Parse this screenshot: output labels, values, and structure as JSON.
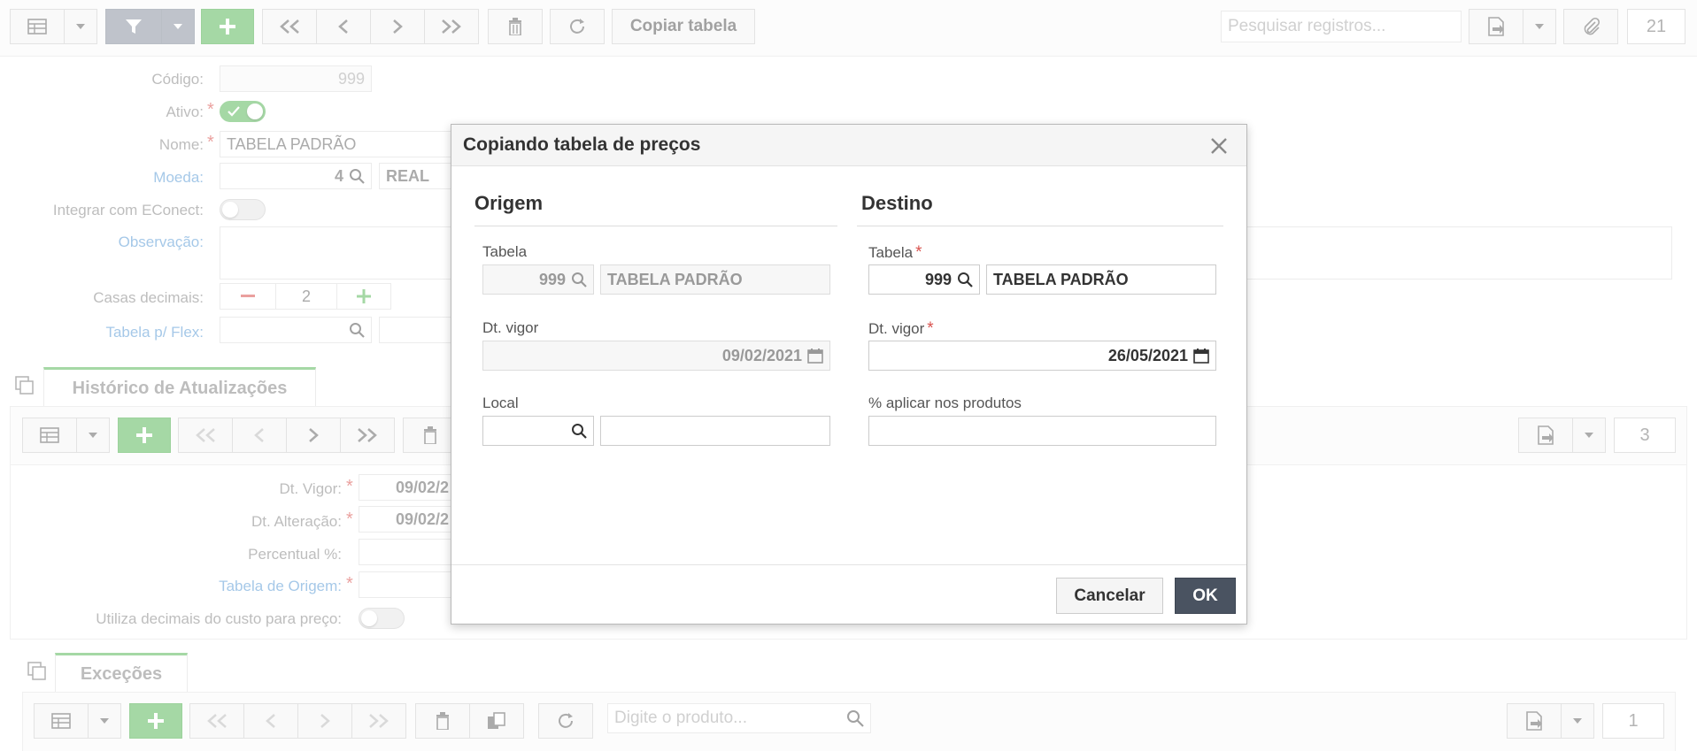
{
  "toolbar": {
    "copy_table_label": "Copiar tabela",
    "search_placeholder": "Pesquisar registros...",
    "record_count": "21"
  },
  "form": {
    "codigo_label": "Código:",
    "codigo_value": "999",
    "ativo_label": "Ativo:",
    "ativo_on": true,
    "nome_label": "Nome:",
    "nome_value": "TABELA PADRÃO",
    "moeda_label": "Moeda:",
    "moeda_code": "4",
    "moeda_name": "REAL",
    "econect_label": "Integrar com EConect:",
    "obs_label": "Observação:",
    "casas_label": "Casas decimais:",
    "casas_value": "2",
    "flex_label": "Tabela p/ Flex:"
  },
  "historico": {
    "tab_label": "Histórico de Atualizações",
    "record_count": "3",
    "dt_vigor_label": "Dt. Vigor:",
    "dt_vigor_value": "09/02/2",
    "dt_alt_label": "Dt. Alteração:",
    "dt_alt_value": "09/02/2",
    "percentual_label": "Percentual %:",
    "origem_label": "Tabela de Origem:",
    "decimais_label": "Utiliza decimais do custo para preço:"
  },
  "excecoes": {
    "tab_label": "Exceções",
    "search_placeholder": "Digite o produto...",
    "record_count": "1"
  },
  "modal": {
    "title": "Copiando tabela de preços",
    "origem": {
      "heading": "Origem",
      "tabela_label": "Tabela",
      "tabela_code": "999",
      "tabela_name": "TABELA PADRÃO",
      "dt_vigor_label": "Dt. vigor",
      "dt_vigor_value": "09/02/2021",
      "local_label": "Local"
    },
    "destino": {
      "heading": "Destino",
      "tabela_label": "Tabela",
      "tabela_code": "999",
      "tabela_name": "TABELA PADRÃO",
      "dt_vigor_label": "Dt. vigor",
      "dt_vigor_value": "26/05/2021",
      "aplicar_label": "% aplicar nos produtos"
    },
    "cancel_label": "Cancelar",
    "ok_label": "OK"
  },
  "colors": {
    "accent_green": "#5cb85c",
    "link_blue": "#5b9bd5",
    "required_red": "#d9534f",
    "ok_button": "#4a5361"
  }
}
